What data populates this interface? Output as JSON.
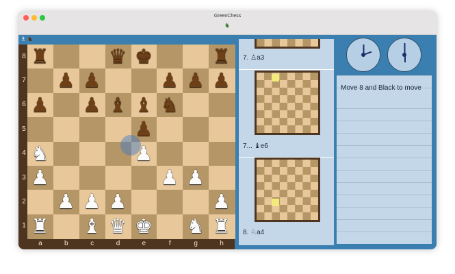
{
  "window": {
    "title": "GreenChess"
  },
  "board": {
    "ranks": [
      "8",
      "7",
      "6",
      "5",
      "4",
      "3",
      "2",
      "1"
    ],
    "files": [
      "a",
      "b",
      "c",
      "d",
      "e",
      "f",
      "g",
      "h"
    ],
    "pieces": [
      {
        "sq": "a8",
        "glyph": "♜",
        "color": "black"
      },
      {
        "sq": "d8",
        "glyph": "♛",
        "color": "black"
      },
      {
        "sq": "e8",
        "glyph": "♚",
        "color": "black"
      },
      {
        "sq": "h8",
        "glyph": "♜",
        "color": "black"
      },
      {
        "sq": "b7",
        "glyph": "♟",
        "color": "black"
      },
      {
        "sq": "c7",
        "glyph": "♟",
        "color": "black"
      },
      {
        "sq": "f7",
        "glyph": "♟",
        "color": "black"
      },
      {
        "sq": "g7",
        "glyph": "♟",
        "color": "black"
      },
      {
        "sq": "h7",
        "glyph": "♟",
        "color": "black"
      },
      {
        "sq": "a6",
        "glyph": "♟",
        "color": "black"
      },
      {
        "sq": "c6",
        "glyph": "♟",
        "color": "black"
      },
      {
        "sq": "d6",
        "glyph": "♝",
        "color": "black"
      },
      {
        "sq": "e6",
        "glyph": "♝",
        "color": "black"
      },
      {
        "sq": "f6",
        "glyph": "♞",
        "color": "black"
      },
      {
        "sq": "e5",
        "glyph": "♟",
        "color": "black"
      },
      {
        "sq": "a4",
        "glyph": "♞",
        "color": "white"
      },
      {
        "sq": "e4",
        "glyph": "♟",
        "color": "white"
      },
      {
        "sq": "a3",
        "glyph": "♟",
        "color": "white"
      },
      {
        "sq": "f3",
        "glyph": "♟",
        "color": "white"
      },
      {
        "sq": "g3",
        "glyph": "♟",
        "color": "white"
      },
      {
        "sq": "b2",
        "glyph": "♟",
        "color": "white"
      },
      {
        "sq": "c2",
        "glyph": "♟",
        "color": "white"
      },
      {
        "sq": "d2",
        "glyph": "♟",
        "color": "white"
      },
      {
        "sq": "h2",
        "glyph": "♟",
        "color": "white"
      },
      {
        "sq": "a1",
        "glyph": "♜",
        "color": "white"
      },
      {
        "sq": "c1",
        "glyph": "♝",
        "color": "white"
      },
      {
        "sq": "d1",
        "glyph": "♛",
        "color": "white"
      },
      {
        "sq": "e1",
        "glyph": "♚",
        "color": "white"
      },
      {
        "sq": "g1",
        "glyph": "♞",
        "color": "white"
      },
      {
        "sq": "h1",
        "glyph": "♜",
        "color": "white"
      }
    ]
  },
  "moves": [
    {
      "label": "7. ♙a3"
    },
    {
      "label": "7... ♝e6"
    },
    {
      "label": "8. ♘a4"
    }
  ],
  "status": {
    "text": "Move 8 and Black to move"
  },
  "colors": {
    "light": "#e8c89a",
    "dark": "#b59667",
    "frame": "#4e3520",
    "accent": "#3a7fb0",
    "panel": "#c4d7e8"
  },
  "icons": {
    "close": "close-traffic-light",
    "minimize": "minimize-traffic-light",
    "zoom": "zoom-traffic-light",
    "app": "frog-icon"
  }
}
